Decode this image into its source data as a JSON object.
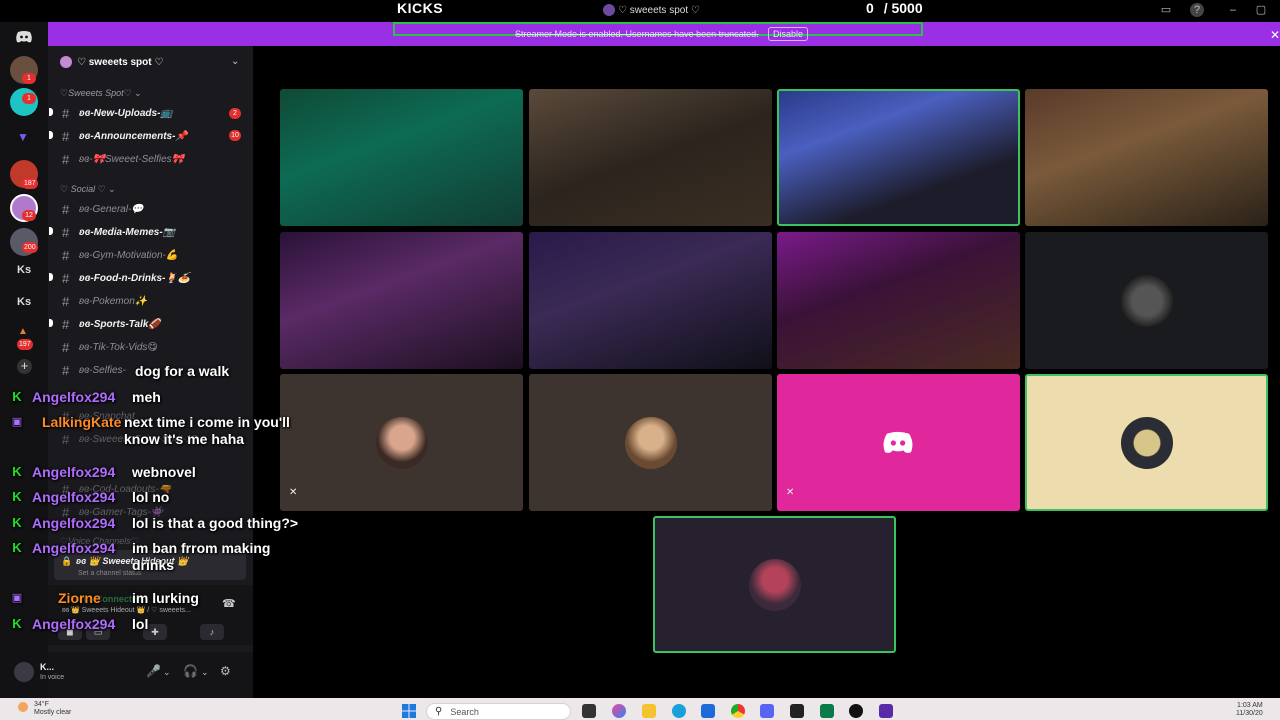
{
  "topbar": {
    "title": "KICKS",
    "server_name": "♡ sweeets spot ♡",
    "counter": "0",
    "counter_total": "/ 5000"
  },
  "banner": {
    "message": "Streamer Mode is enabled. Usernames have been truncated.",
    "disable_label": "Disable"
  },
  "rail": {
    "badges": [
      "1",
      "1",
      "187",
      "12",
      "200",
      "197"
    ],
    "texts": [
      "Ks",
      "Ks"
    ]
  },
  "sidebar": {
    "server_title": "♡ sweeets spot ♡",
    "categories": [
      "♡Sweeets Spot♡ ⌄",
      "♡ Social ♡ ⌄",
      "♡Voice Channels♡"
    ],
    "channels": [
      {
        "label": "ʚɞ-New-Uploads-📺",
        "badge": "2"
      },
      {
        "label": "ʚɞ-Announcements-📌",
        "badge": "10"
      },
      {
        "label": "ʚɞ-🎀Sweeet-Selfies🎀"
      },
      {
        "label": "ʚɞ-General-💬"
      },
      {
        "label": "ʚɞ-Media-Memes-📷"
      },
      {
        "label": "ʚɞ-Gym-Motivation-💪"
      },
      {
        "label": "ʚɞ-Food-n-Drinks-🍹🍝"
      },
      {
        "label": "ʚɞ-Pokemon✨"
      },
      {
        "label": "ʚɞ-Sports-Talk🏈"
      },
      {
        "label": "ʚɞ-Tik-Tok-Vids😋"
      },
      {
        "label": "ʚɞ-Selfies-"
      },
      {
        "label": "ʚɞ-Snapchat"
      },
      {
        "label": "ʚɞ-Sweeets-Spicy-Spot-18"
      },
      {
        "label": "ʚɞ-Cod-Loadouts-🔫"
      },
      {
        "label": "ʚɞ-Gamer-Tags-👾"
      }
    ],
    "voice_channel": {
      "title": "ʚɞ 👑 Sweeets Hideout 👑",
      "sub": "Set a channel status"
    },
    "voice_connected": {
      "status": "Voice Connected",
      "location": "ʚɞ 👑 Sweeets Hideout 👑 / ♡ sweeets..."
    },
    "user": {
      "name": "K...",
      "status": "In voice"
    }
  },
  "chat": [
    {
      "platform": "none",
      "user": "",
      "message": "dog for a walk"
    },
    {
      "platform": "kick",
      "user": "Angelfox294",
      "message": "meh"
    },
    {
      "platform": "twitch",
      "user": "LalkingKate",
      "message": "next time i come in you'll know it's me haha"
    },
    {
      "platform": "kick",
      "user": "Angelfox294",
      "message": "webnovel"
    },
    {
      "platform": "kick",
      "user": "Angelfox294",
      "message": "lol no"
    },
    {
      "platform": "kick",
      "user": "Angelfox294",
      "message": "lol is that a good thing?>"
    },
    {
      "platform": "kick",
      "user": "Angelfox294",
      "message": "im ban frrom making drinks"
    },
    {
      "platform": "twitch",
      "user": "Ziorne",
      "message": "im lurking"
    },
    {
      "platform": "kick",
      "user": "Angelfox294",
      "message": "lol"
    }
  ],
  "colors": {
    "banner": "#9b2fe6",
    "speaking_border": "#3ac35e",
    "kick_green": "#1fe021",
    "twitch_purple": "#a970ff",
    "chat_user_kick": "#b06cff",
    "chat_user_twitch": "#ff8a24",
    "discord_tile": "#e0289c",
    "beige_tile": "#ecdcae"
  },
  "taskbar": {
    "weather_temp": "34°F",
    "weather_desc": "Mostly clear",
    "search_placeholder": "Search",
    "time": "1:03 AM",
    "date": "11/30/20"
  }
}
